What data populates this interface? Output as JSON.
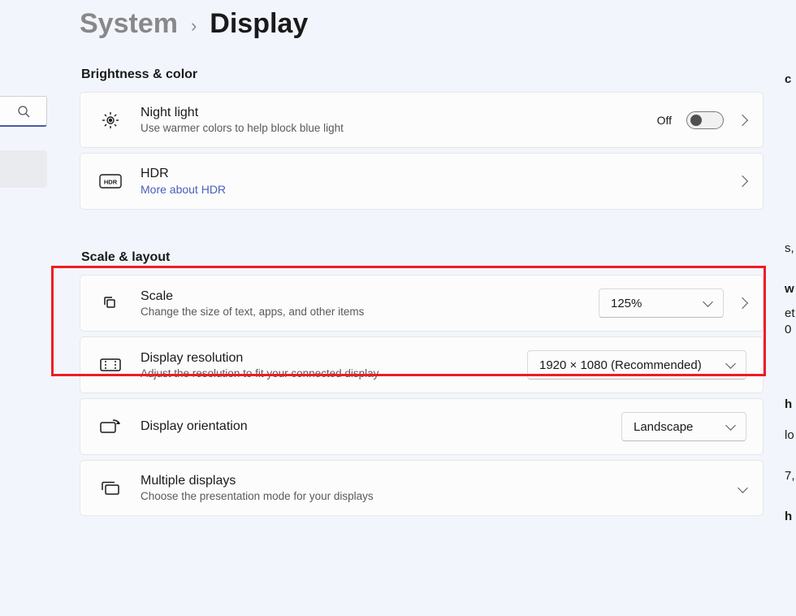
{
  "breadcrumb": {
    "parent": "System",
    "current": "Display"
  },
  "sections": {
    "brightness": {
      "title": "Brightness & color",
      "night_light": {
        "title": "Night light",
        "sub": "Use warmer colors to help block blue light",
        "toggle_label": "Off"
      },
      "hdr": {
        "title": "HDR",
        "link": "More about HDR"
      }
    },
    "scale": {
      "title": "Scale & layout",
      "scale_row": {
        "title": "Scale",
        "sub": "Change the size of text, apps, and other items",
        "value": "125%"
      },
      "resolution": {
        "title": "Display resolution",
        "sub": "Adjust the resolution to fit your connected display",
        "value": "1920 × 1080 (Recommended)"
      },
      "orientation": {
        "title": "Display orientation",
        "value": "Landscape"
      },
      "multiple": {
        "title": "Multiple displays",
        "sub": "Choose the presentation mode for your displays"
      }
    }
  },
  "edge": {
    "e1": "c",
    "e2": "s,",
    "e3": "w",
    "e4": "et",
    "e5": "0",
    "e6": "h",
    "e7": "lo",
    "e8": "7,",
    "e9": "h"
  }
}
